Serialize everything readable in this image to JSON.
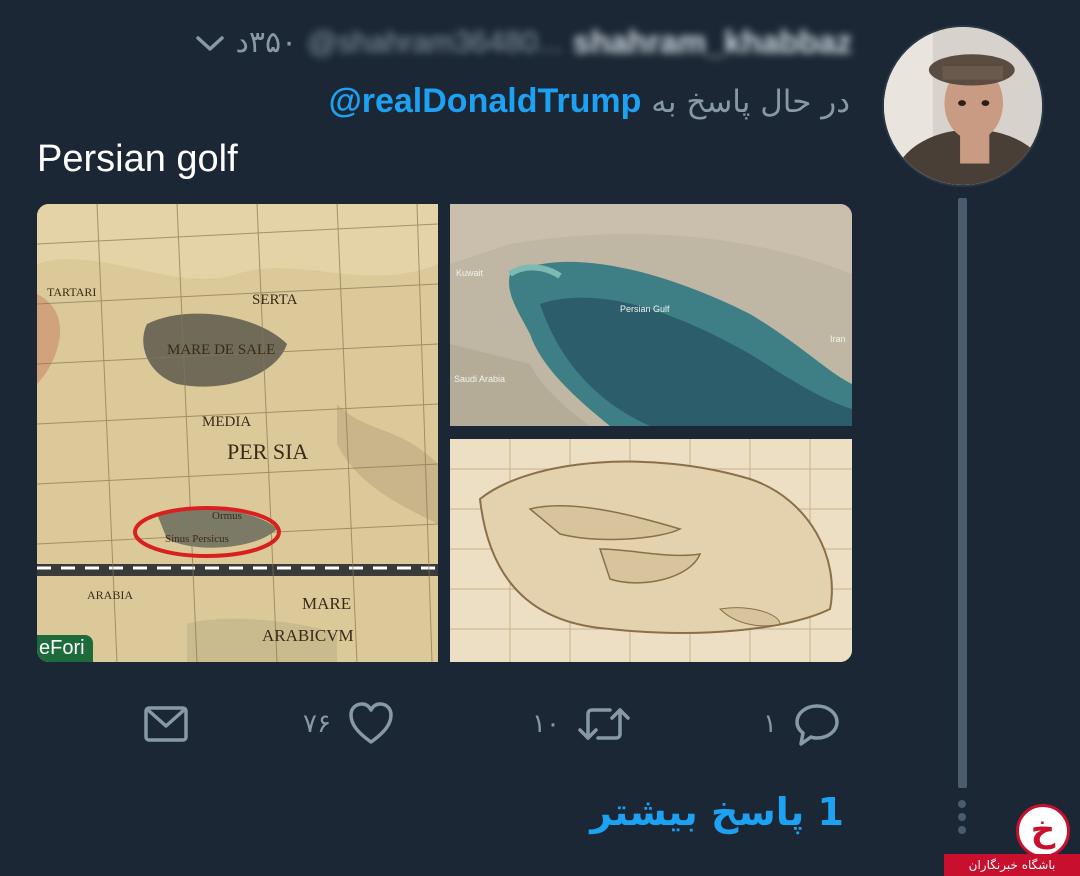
{
  "tweet": {
    "display_name": "shahram_khabbaz",
    "handle": "@shahram36480...",
    "time": "۳۵۰د",
    "reply_prefix": "در حال پاسخ به",
    "reply_to": "@realDonaldTrump",
    "text": "Persian golf",
    "more_replies_label": "1 پاسخ بیشتر"
  },
  "media": {
    "left_map": {
      "watermark": "eFori",
      "labels": [
        "MARE DE SALE",
        "PER SIA",
        "MEDIA",
        "ARABICVM",
        "MARE",
        "TARTARI",
        "SERTA",
        "Ormus",
        "Sinus Persicus",
        "ARABIA"
      ]
    },
    "top_right_photo": {
      "labels": [
        "Kuwait",
        "Persian Gulf",
        "Iran",
        "Saudi Arabia"
      ]
    }
  },
  "actions": {
    "reply_count": "۱",
    "retweet_count": "۱۰",
    "like_count": "۷۶"
  },
  "icons": {
    "reply": "reply-icon",
    "retweet": "retweet-icon",
    "like": "heart-icon",
    "share": "envelope-icon",
    "more": "chevron-down-icon"
  },
  "logo": {
    "glyph": "خ",
    "caption": "باشگاه خبرنگاران"
  },
  "colors": {
    "background": "#1b2734",
    "accent": "#1da1f2",
    "muted": "#8899a6",
    "logo_red": "#c8102e"
  }
}
